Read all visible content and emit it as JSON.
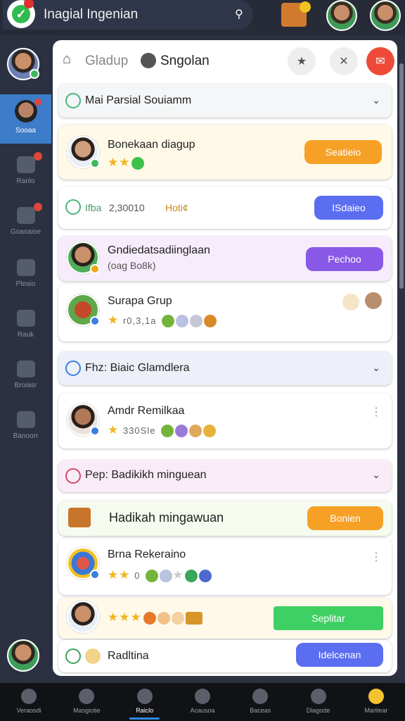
{
  "app": {
    "title": "Inagial Ingenian"
  },
  "header_tabs": {
    "tab1": "Gladup",
    "tab2": "Sngolan"
  },
  "sections": {
    "s1_title": "Mai Parsial Souiamm",
    "s2_title": "Fhz: Biaic Glamdlera",
    "s3_title": "Pep: Badikikh minguean",
    "s4_title": "Hadikah mingawuan"
  },
  "rows": {
    "r1_name": "Bonekaan diagup",
    "r1_button": "Seatieio",
    "r2_label": "Ifba",
    "r2_value": "2,30010",
    "r2_note": "Hoti¢",
    "r2_button": "ISdaieo",
    "r3_name": "Gndiedatsadiinglaan",
    "r3_sub": "(oag Bo8k)",
    "r3_button": "Pechoo",
    "r4_name": "Surapa Grup",
    "r4_stats": "r0,3,1a",
    "r5_name": "Amdr Remilkaa",
    "r5_stats": "330Sle",
    "r6_button": "Bonien",
    "r7_name": "Brna Rekeraino",
    "r7_stats": "0",
    "r8_button": "Seplitar",
    "r9_name": "Radltina",
    "r9_button": "Idelcenan"
  },
  "rail": {
    "active_label": "Sooaa",
    "item2": "Ranlo",
    "item3": "Goaoaioe",
    "item4": "Pleaio",
    "item5": "Rauk",
    "item6": "Broiasr",
    "item7": "Banoorr"
  },
  "bottom_nav": [
    "Veraosdi",
    "Masgiotie",
    "Raiclo",
    "Acausoa",
    "Baceas",
    "Dlagode",
    "Maritear"
  ],
  "colors": {
    "orange": "#f6a125",
    "blue_btn": "#5b6df0",
    "purple_btn": "#8a58e6",
    "green_btn": "#3fd064",
    "active_rail": "#3c7cc8"
  }
}
